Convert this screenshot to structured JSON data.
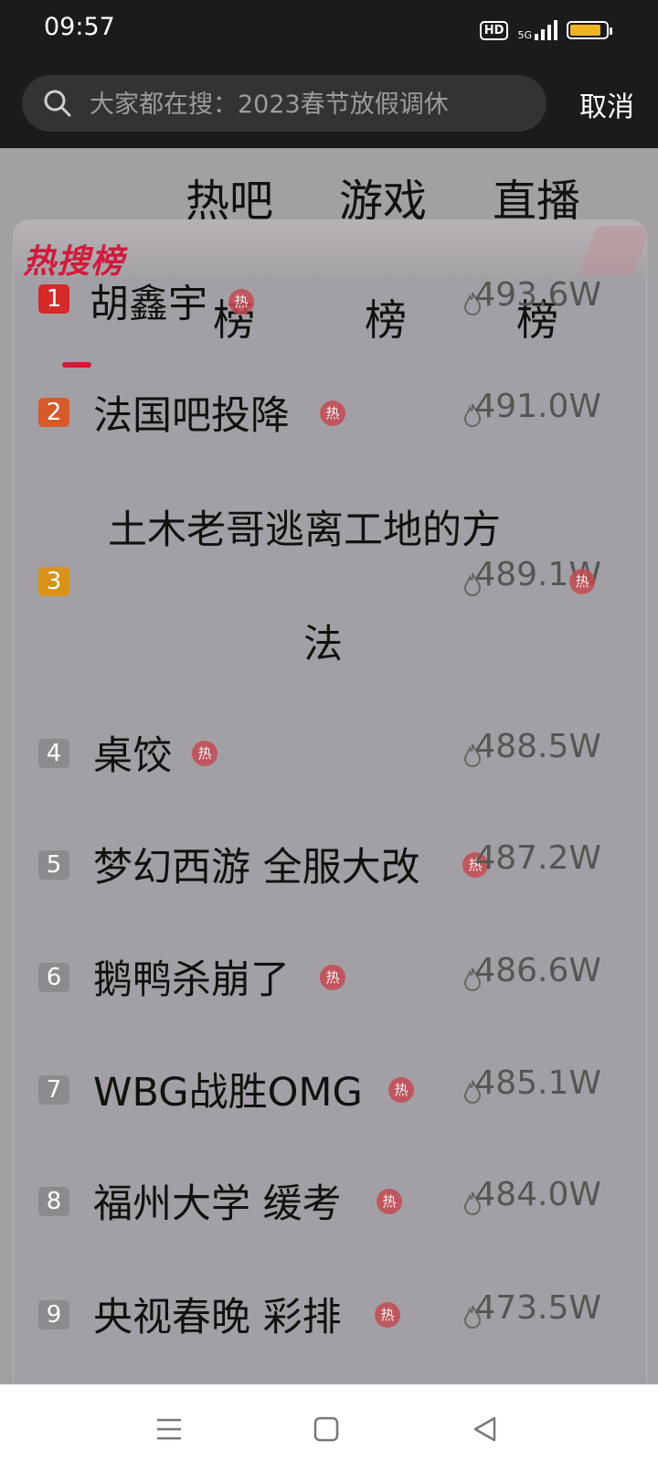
{
  "status_bar": {
    "time": "09:57",
    "hd": "HD",
    "network": "5G"
  },
  "search": {
    "placeholder": "大家都在搜：2023春节放假调休",
    "cancel": "取消"
  },
  "tabs": [
    {
      "line1": "热吧",
      "line2": "榜"
    },
    {
      "line1": "游戏",
      "line2": "榜"
    },
    {
      "line1": "直播",
      "line2": "榜"
    }
  ],
  "panel": {
    "title": "热搜榜",
    "hot_tag": "热"
  },
  "list": [
    {
      "rank": "1",
      "title": "胡鑫宇",
      "heat": "493.6W",
      "rank_color": "#d42a2a"
    },
    {
      "rank": "2",
      "title": "法国吧投降",
      "heat": "491.0W",
      "rank_color": "#d65a2a"
    },
    {
      "rank": "3",
      "title": "土木老哥逃离工地的方",
      "title2": "法",
      "heat": "489.1W",
      "rank_color": "#d9921a"
    },
    {
      "rank": "4",
      "title": "桌饺",
      "heat": "488.5W",
      "rank_color": "#8d8a8e"
    },
    {
      "rank": "5",
      "title": "梦幻西游 全服大改",
      "heat": "487.2W",
      "rank_color": "#8d8a8e"
    },
    {
      "rank": "6",
      "title": "鹅鸭杀崩了",
      "heat": "486.6W",
      "rank_color": "#8d8a8e"
    },
    {
      "rank": "7",
      "title": "WBG战胜OMG",
      "heat": "485.1W",
      "rank_color": "#8d8a8e"
    },
    {
      "rank": "8",
      "title": "福州大学 缓考",
      "heat": "484.0W",
      "rank_color": "#8d8a8e"
    },
    {
      "rank": "9",
      "title": "央视春晚 彩排",
      "heat": "473.5W",
      "rank_color": "#8d8a8e"
    }
  ]
}
